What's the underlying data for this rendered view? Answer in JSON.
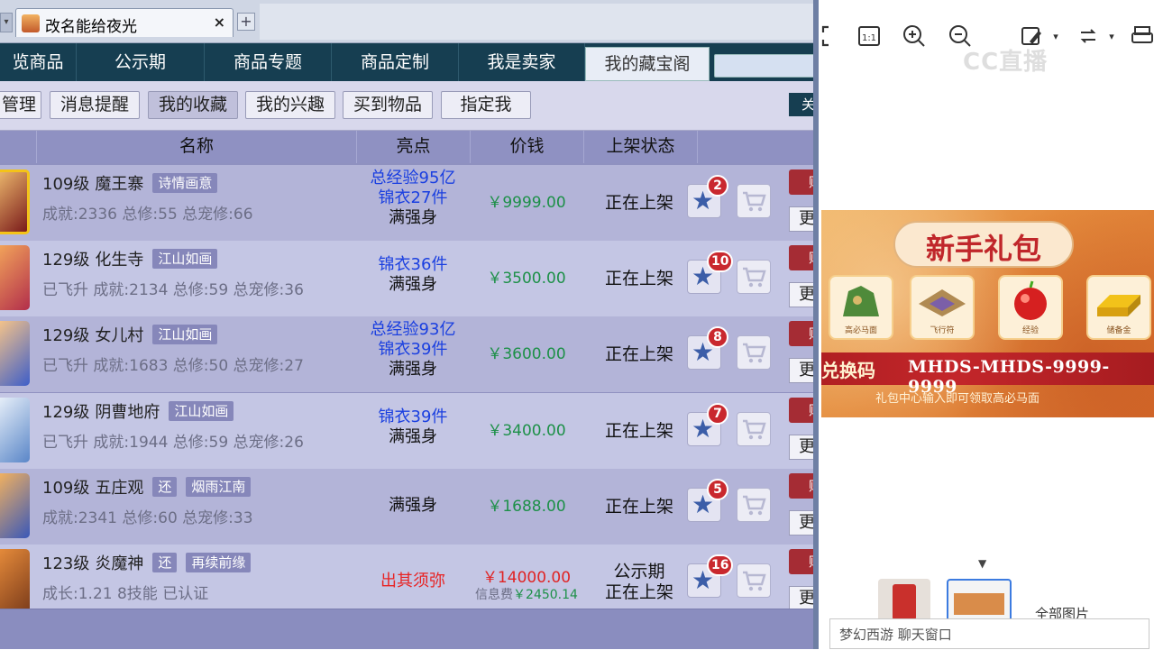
{
  "app": {
    "tab_title": "改名能给夜光",
    "tab_close": "×",
    "tab_add": "+"
  },
  "nav": {
    "items": [
      "览商品",
      "公示期",
      "商品专题",
      "商品定制",
      "我是卖家",
      "我的藏宝阁"
    ],
    "active_index": 5
  },
  "subnav": {
    "items": [
      "管理",
      "消息提醒",
      "我的收藏",
      "我的兴趣",
      "买到物品",
      "指定我"
    ],
    "active_index": 2,
    "right_btn": "关"
  },
  "table": {
    "headers": [
      "名称",
      "亮点",
      "价钱",
      "上架状态"
    ],
    "rows": [
      {
        "level": "109级",
        "school": "魔王寨",
        "tags": [
          "诗情画意"
        ],
        "stats": "成就:2336 总修:55 总宠修:66",
        "highlights": [
          {
            "text": "总经验95亿",
            "color": "blue"
          },
          {
            "text": "锦衣27件",
            "color": "blue"
          },
          {
            "text": "满强身",
            "color": "black"
          }
        ],
        "price": "￥9999.00",
        "status": "正在上架",
        "badge": "2",
        "buy": "购",
        "more": "更"
      },
      {
        "level": "129级",
        "school": "化生寺",
        "tags": [
          "江山如画"
        ],
        "stats": "已飞升 成就:2134 总修:59 总宠修:36",
        "highlights": [
          {
            "text": "锦衣36件",
            "color": "blue"
          },
          {
            "text": "满强身",
            "color": "black"
          }
        ],
        "price": "￥3500.00",
        "status": "正在上架",
        "badge": "10",
        "buy": "购",
        "more": "更"
      },
      {
        "level": "129级",
        "school": "女儿村",
        "tags": [
          "江山如画"
        ],
        "stats": "已飞升 成就:1683 总修:50 总宠修:27",
        "highlights": [
          {
            "text": "总经验93亿",
            "color": "blue"
          },
          {
            "text": "锦衣39件",
            "color": "blue"
          },
          {
            "text": "满强身",
            "color": "black"
          }
        ],
        "price": "￥3600.00",
        "status": "正在上架",
        "badge": "8",
        "buy": "购",
        "more": "更"
      },
      {
        "level": "129级",
        "school": "阴曹地府",
        "tags": [
          "江山如画"
        ],
        "stats": "已飞升 成就:1944 总修:59 总宠修:26",
        "highlights": [
          {
            "text": "锦衣39件",
            "color": "blue"
          },
          {
            "text": "满强身",
            "color": "black"
          }
        ],
        "price": "￥3400.00",
        "status": "正在上架",
        "badge": "7",
        "buy": "购",
        "more": "更"
      },
      {
        "level": "109级",
        "school": "五庄观",
        "tags": [
          "还",
          "烟雨江南"
        ],
        "stats": "成就:2341 总修:60 总宠修:33",
        "highlights": [
          {
            "text": "满强身",
            "color": "black"
          }
        ],
        "price": "￥1688.00",
        "status": "正在上架",
        "badge": "5",
        "buy": "购",
        "more": "更"
      },
      {
        "level": "123级",
        "school": "炎魔神",
        "tags": [
          "还",
          "再续前缘"
        ],
        "stats": "成长:1.21 8技能 已认证",
        "highlights": [
          {
            "text": "出其须弥",
            "color": "red"
          }
        ],
        "price": "￥14000.00",
        "fee_label": "信息费",
        "fee": "￥2450.14",
        "status": "公示期",
        "status2": "正在上架",
        "badge": "16",
        "buy": "购",
        "more": "更"
      }
    ]
  },
  "right": {
    "banner_title": "新手礼包",
    "gifts": [
      "高必马面",
      "飞行符",
      "经验",
      "储备金"
    ],
    "code_label": "兑换码",
    "code_value": "MHDS-MHDS-9999-9999",
    "code_note": "礼包中心输入即可领取高必马面",
    "all_images": "全部图片",
    "chat_placeholder": "梦幻西游 聊天窗口",
    "watermark": "CC直播"
  },
  "colors": {
    "nav_bg": "#163e51",
    "row_light": "#c4c6e4",
    "row_dark": "#b3b4d8",
    "price_green": "#1d9048",
    "highlight_blue": "#1a3fe0",
    "highlight_red": "#e82323",
    "badge_red": "#c9282e"
  }
}
